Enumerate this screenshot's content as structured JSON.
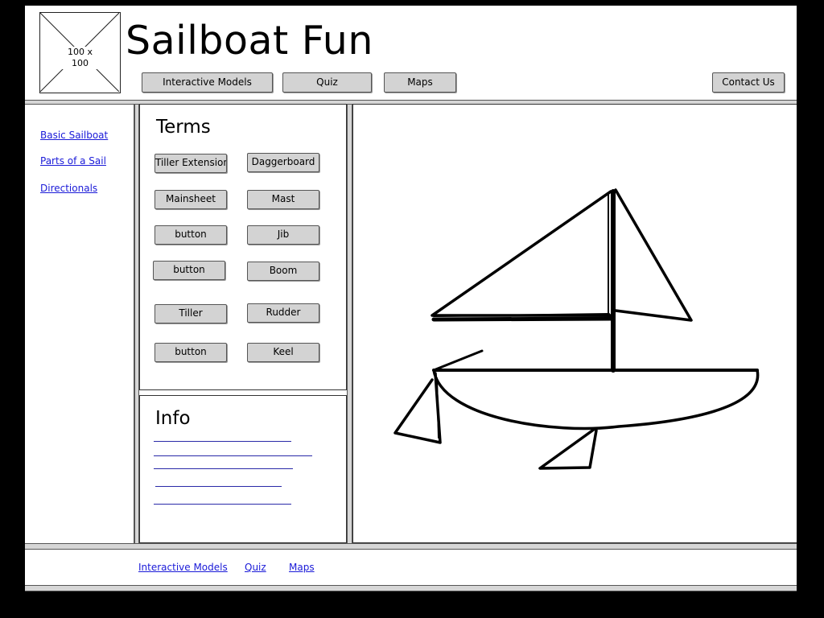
{
  "header": {
    "logo_placeholder": "100 x 100",
    "title": "Sailboat Fun",
    "nav": [
      "Interactive Models",
      "Quiz",
      "Maps"
    ],
    "contact": "Contact Us"
  },
  "sidebar": {
    "links": [
      "Basic Sailboat",
      "Parts of a Sail",
      "Directionals"
    ]
  },
  "terms": {
    "heading": "Terms",
    "buttons": [
      "Tiller Extension",
      "Daggerboard",
      "Mainsheet",
      "Mast",
      "button",
      "Jib",
      "button",
      "Boom",
      "Tiller",
      "Rudder",
      "button",
      "Keel"
    ]
  },
  "info": {
    "heading": "Info"
  },
  "footer": {
    "links": [
      "Interactive Models",
      "Quiz",
      "Maps"
    ]
  }
}
